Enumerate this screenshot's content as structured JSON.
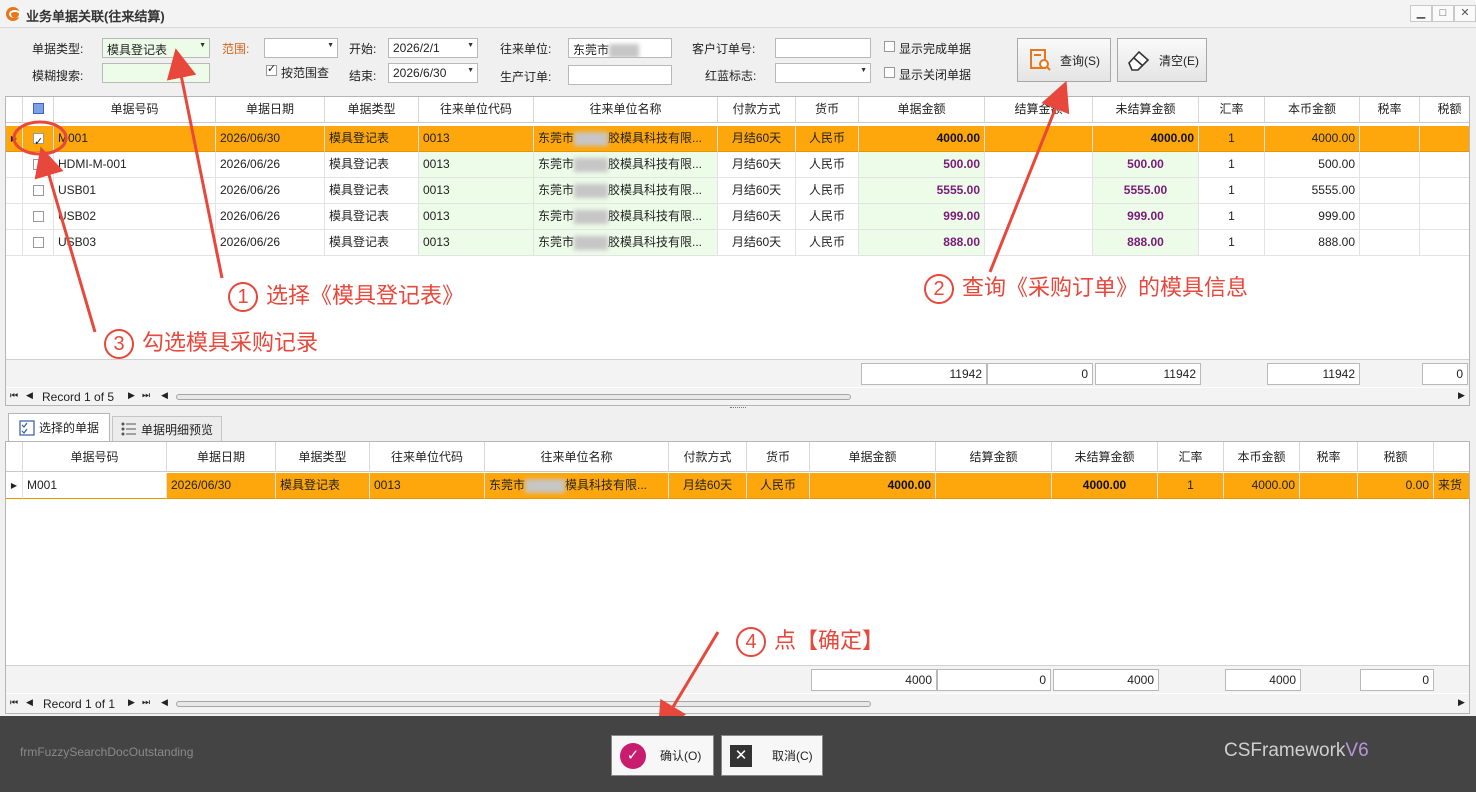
{
  "window": {
    "title": "业务单据关联(往来结算)"
  },
  "filters": {
    "doc_type_label": "单据类型:",
    "doc_type_value": "模具登记表",
    "range_label": "范围:",
    "range_value": "",
    "start_label": "开始:",
    "start_value": "2026/2/1",
    "end_label": "结束:",
    "end_value": "2026/6/30",
    "partner_label": "往来单位:",
    "partner_value": "东莞市",
    "customer_order_label": "客户订单号:",
    "customer_order_value": "",
    "red_blue_label": "红蓝标志:",
    "red_blue_value": "",
    "fuzzy_label": "模糊搜索:",
    "fuzzy_value": "",
    "by_range_label": "按范围查",
    "production_order_label": "生产订单:",
    "production_order_value": "",
    "show_completed_label": "显示完成单据",
    "show_closed_label": "显示关闭单据",
    "query_button": "查询(S)",
    "clear_button": "清空(E)"
  },
  "top_grid": {
    "columns": [
      "单据号码",
      "单据日期",
      "单据类型",
      "往来单位代码",
      "往来单位名称",
      "付款方式",
      "货币",
      "单据金额",
      "结算金额",
      "未结算金额",
      "汇率",
      "本币金额",
      "税率",
      "税额"
    ],
    "rows": [
      {
        "doc_no": "M001",
        "date": "2026/06/30",
        "type": "模具登记表",
        "code": "0013",
        "name_a": "东莞市",
        "name_b": "胶模具科技有限...",
        "pay": "月结60天",
        "cur": "人民币",
        "amount": "4000.00",
        "settled": "",
        "unsettled": "4000.00",
        "rate": "1",
        "local": "4000.00"
      },
      {
        "doc_no": "HDMI-M-001",
        "date": "2026/06/26",
        "type": "模具登记表",
        "code": "0013",
        "name_a": "东莞市",
        "name_b": "胶模具科技有限...",
        "pay": "月结60天",
        "cur": "人民币",
        "amount": "500.00",
        "settled": "",
        "unsettled": "500.00",
        "rate": "1",
        "local": "500.00"
      },
      {
        "doc_no": "USB01",
        "date": "2026/06/26",
        "type": "模具登记表",
        "code": "0013",
        "name_a": "东莞市",
        "name_b": "胶模具科技有限...",
        "pay": "月结60天",
        "cur": "人民币",
        "amount": "5555.00",
        "settled": "",
        "unsettled": "5555.00",
        "rate": "1",
        "local": "5555.00"
      },
      {
        "doc_no": "USB02",
        "date": "2026/06/26",
        "type": "模具登记表",
        "code": "0013",
        "name_a": "东莞市",
        "name_b": "胶模具科技有限...",
        "pay": "月结60天",
        "cur": "人民币",
        "amount": "999.00",
        "settled": "",
        "unsettled": "999.00",
        "rate": "1",
        "local": "999.00"
      },
      {
        "doc_no": "USB03",
        "date": "2026/06/26",
        "type": "模具登记表",
        "code": "0013",
        "name_a": "东莞市",
        "name_b": "胶模具科技有限...",
        "pay": "月结60天",
        "cur": "人民币",
        "amount": "888.00",
        "settled": "",
        "unsettled": "888.00",
        "rate": "1",
        "local": "888.00"
      }
    ],
    "summary": {
      "amount": "11942",
      "settled": "0",
      "unsettled": "11942",
      "local": "11942",
      "tax": "0"
    },
    "record_text": "Record 1 of 5"
  },
  "tabs": {
    "selected": "选择的单据",
    "preview": "单据明细预览"
  },
  "bottom_grid": {
    "columns": [
      "单据号码",
      "单据日期",
      "单据类型",
      "往来单位代码",
      "往来单位名称",
      "付款方式",
      "货币",
      "单据金额",
      "结算金额",
      "未结算金额",
      "汇率",
      "本币金额",
      "税率",
      "税额",
      ""
    ],
    "row": {
      "doc_no": "M001",
      "date": "2026/06/30",
      "type": "模具登记表",
      "code": "0013",
      "name_a": "东莞市",
      "name_b": "模具科技有限...",
      "pay": "月结60天",
      "cur": "人民币",
      "amount": "4000.00",
      "settled": "",
      "unsettled": "4000.00",
      "rate": "1",
      "local": "4000.00",
      "tax_rate": "",
      "tax": "0.00",
      "extra": "来货"
    },
    "summary": {
      "amount": "4000",
      "settled": "0",
      "unsettled": "4000",
      "local": "4000",
      "tax": "0"
    },
    "record_text": "Record 1 of 1"
  },
  "annotations": {
    "a1_num": "1",
    "a1_text": "选择《模具登记表》",
    "a2_num": "2",
    "a2_text": "查询《采购订单》的模具信息",
    "a3_num": "3",
    "a3_text": "勾选模具采购记录",
    "a4_num": "4",
    "a4_text": "点【确定】"
  },
  "footer": {
    "form_name": "frmFuzzySearchDocOutstanding",
    "ok_button": "确认(O)",
    "cancel_button": "取消(C)",
    "brand": "CSFramework",
    "version": "V6"
  },
  "colors": {
    "selected_row": "#fda70c",
    "annotation": "#e8473b",
    "green_cell": "#edfbe9",
    "amount_text": "#7b1a7b"
  }
}
